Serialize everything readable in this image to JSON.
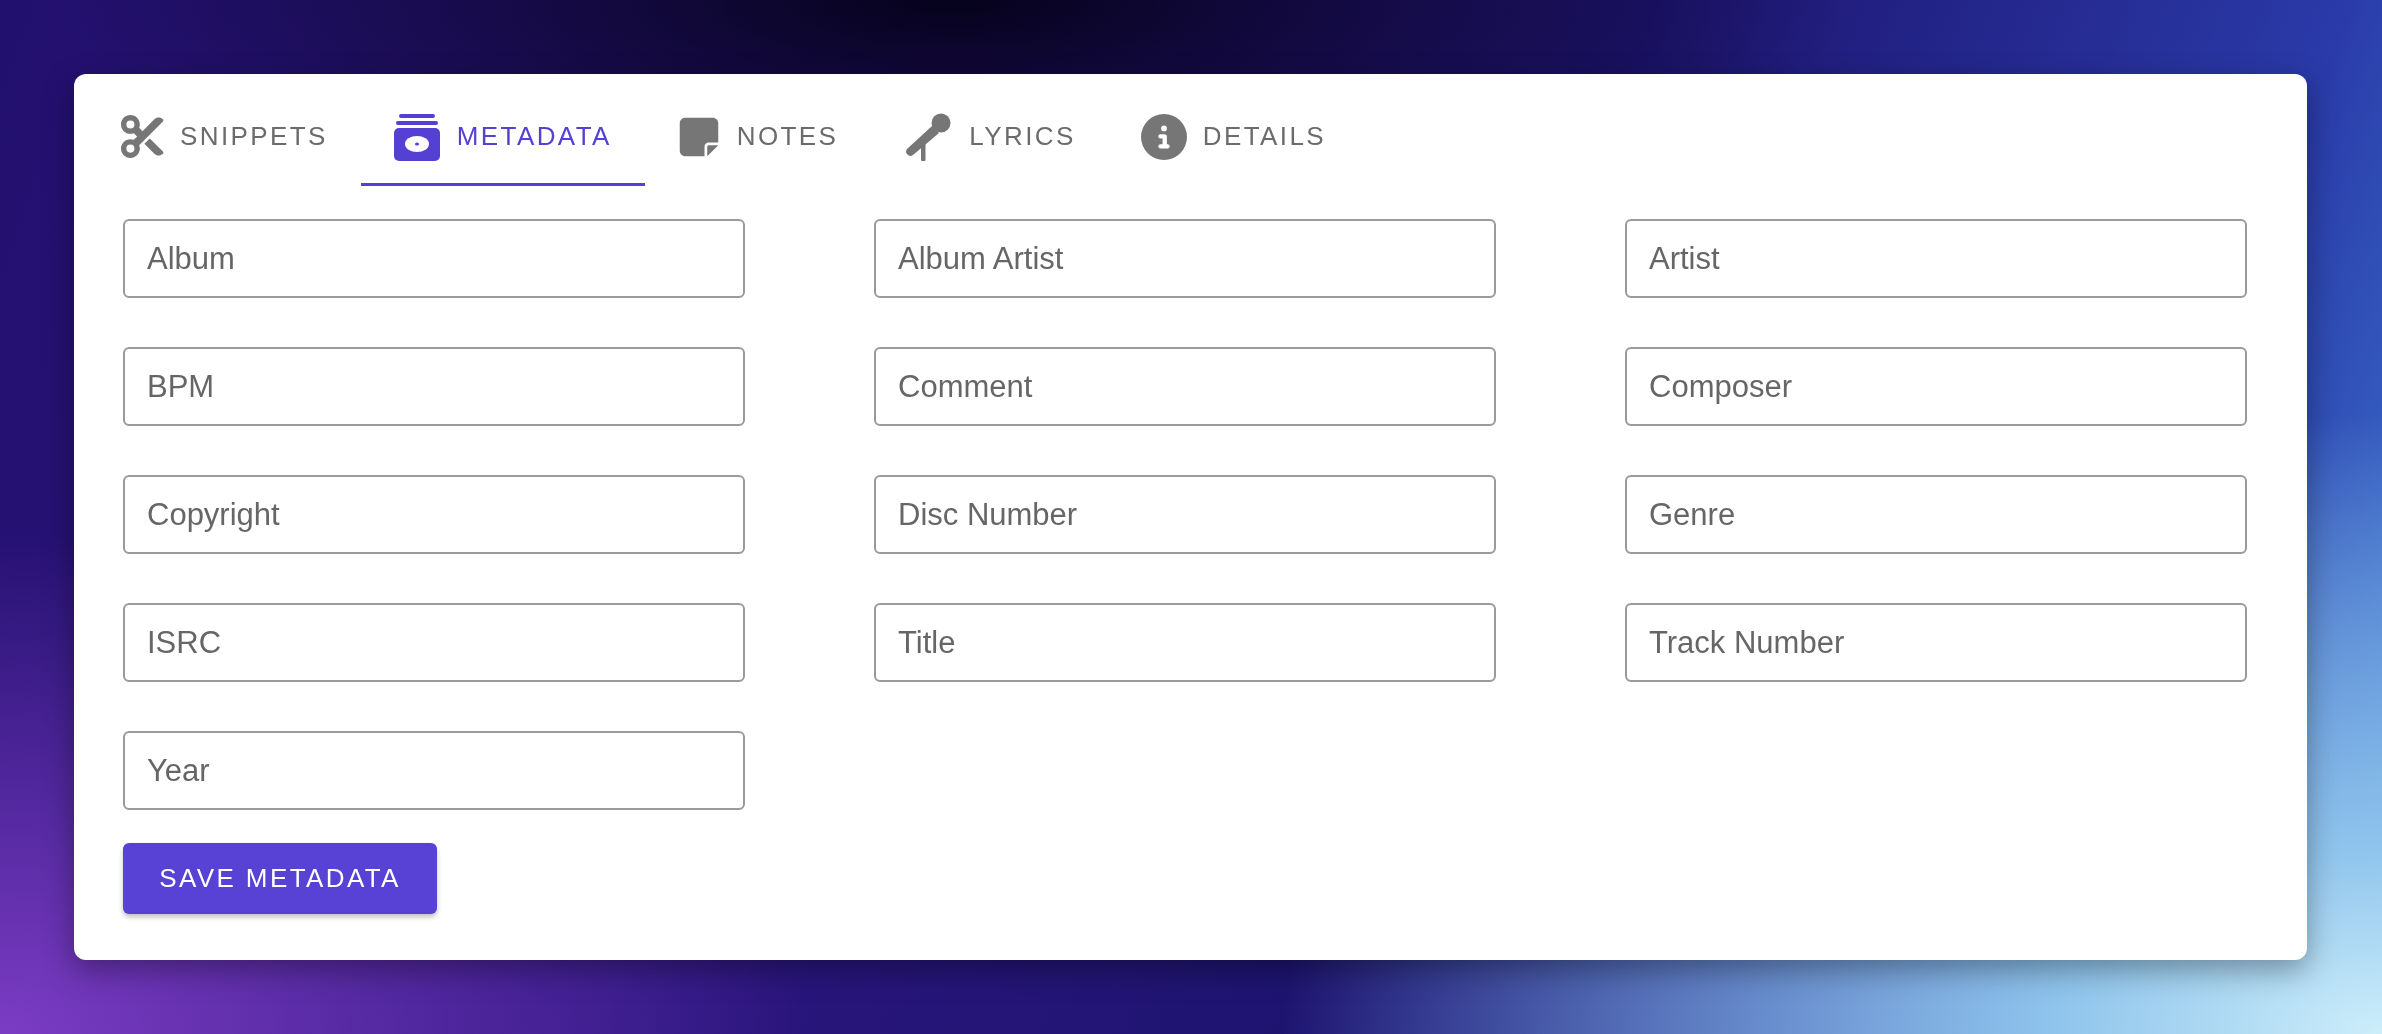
{
  "tabs": [
    {
      "label": "SNIPPETS",
      "selected": false
    },
    {
      "label": "METADATA",
      "selected": true
    },
    {
      "label": "NOTES",
      "selected": false
    },
    {
      "label": "LYRICS",
      "selected": false
    },
    {
      "label": "DETAILS",
      "selected": false
    }
  ],
  "fields": [
    {
      "placeholder": "Album"
    },
    {
      "placeholder": "Album Artist"
    },
    {
      "placeholder": "Artist"
    },
    {
      "placeholder": "BPM"
    },
    {
      "placeholder": "Comment"
    },
    {
      "placeholder": "Composer"
    },
    {
      "placeholder": "Copyright"
    },
    {
      "placeholder": "Disc Number"
    },
    {
      "placeholder": "Genre"
    },
    {
      "placeholder": "ISRC"
    },
    {
      "placeholder": "Title"
    },
    {
      "placeholder": "Track Number"
    },
    {
      "placeholder": "Year"
    }
  ],
  "save_button": {
    "label": "SAVE METADATA"
  }
}
